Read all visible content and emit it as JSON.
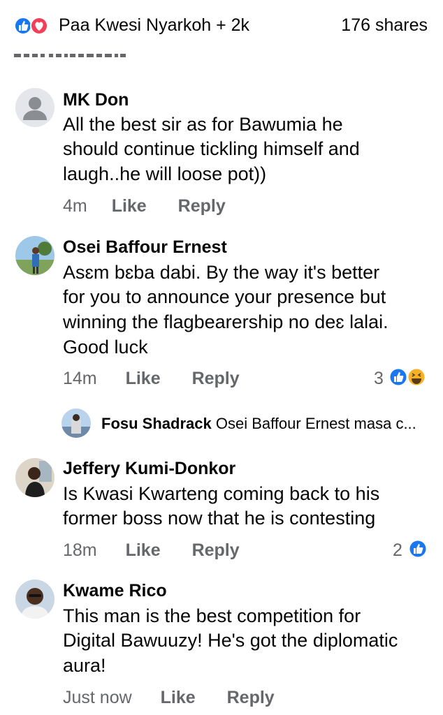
{
  "header": {
    "reactors": "Paa Kwesi Nyarkoh + 2k",
    "shares": "176 shares",
    "reaction_icons": [
      "like-icon",
      "love-icon"
    ]
  },
  "comments": [
    {
      "author": "MK Don",
      "lines": [
        "All the best sir as for Bawumia he",
        "should continue tickling himself and",
        "laugh..he will loose pot))"
      ],
      "time": "4m",
      "like": "Like",
      "reply": "Reply"
    },
    {
      "author": "Osei Baffour Ernest",
      "lines": [
        "Asɛm bɛba dabi. By the way it's better",
        "for you to announce your presence but",
        "winning the flagbearership no deɛ lalai.",
        "Good luck"
      ],
      "time": "14m",
      "like": "Like",
      "reply": "Reply",
      "reaction_count": "3",
      "reaction_icons": [
        "like-icon",
        "haha-icon"
      ],
      "reply_preview": {
        "author": "Fosu Shadrack",
        "text": "Osei Baffour Ernest masa c..."
      }
    },
    {
      "author": "Jeffery Kumi-Donkor",
      "lines": [
        "Is Kwasi Kwarteng coming back to his",
        "former boss now that he is contesting"
      ],
      "time": "18m",
      "like": "Like",
      "reply": "Reply",
      "reaction_count": "2",
      "reaction_icons": [
        "like-icon"
      ]
    },
    {
      "author": "Kwame Rico",
      "lines": [
        "This man is the best competition for",
        "Digital Bawuuzy! He's got the diplomatic",
        "aura!"
      ],
      "time": "Just now",
      "like": "Like",
      "reply": "Reply"
    }
  ],
  "colors": {
    "like_blue": "#1877f2",
    "love_red": "#f33e58",
    "haha_yellow": "#f7b125",
    "meta_gray": "#65676b"
  }
}
